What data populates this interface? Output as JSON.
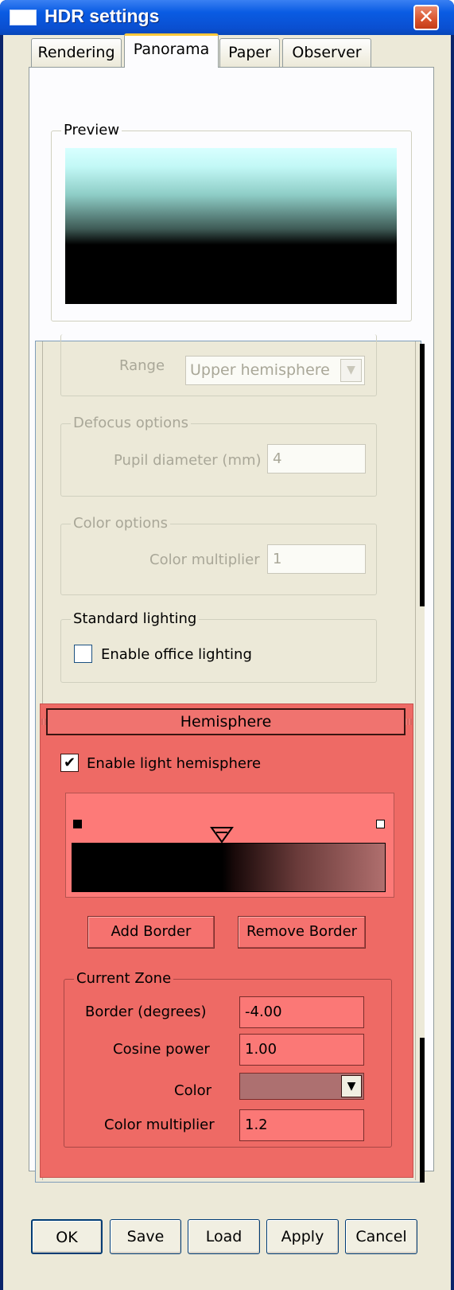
{
  "window": {
    "title": "HDR settings",
    "close_glyph": "✕"
  },
  "tabs": [
    {
      "label": "Rendering",
      "active": false
    },
    {
      "label": "Panorama",
      "active": true
    },
    {
      "label": "Paper",
      "active": false
    },
    {
      "label": "Observer",
      "active": false
    }
  ],
  "preview": {
    "legend": "Preview"
  },
  "range": {
    "label": "Range",
    "value": "Upper hemisphere"
  },
  "defocus": {
    "legend": "Defocus options",
    "pupil_label": "Pupil diameter (mm)",
    "pupil_value": "4"
  },
  "color_options": {
    "legend": "Color options",
    "multiplier_label": "Color multiplier",
    "multiplier_value": "1"
  },
  "standard_lighting": {
    "legend": "Standard lighting",
    "office_label": "Enable office lighting",
    "office_checked": false
  },
  "hemisphere": {
    "header": "Hemisphere",
    "enable_label": "Enable light hemisphere",
    "enable_checked": true,
    "enable_glyph": "✔",
    "add_border": "Add Border",
    "remove_border": "Remove Border",
    "zone_legend": "Current Zone",
    "border_label": "Border (degrees)",
    "border_value": "-4.00",
    "cosine_label": "Cosine power",
    "cosine_value": "1.00",
    "color_label": "Color",
    "color_swatch": "#ad7070",
    "color_multiplier_label": "Color multiplier",
    "color_multiplier_value": "1.2"
  },
  "buttons": {
    "ok": "OK",
    "save": "Save",
    "load": "Load",
    "apply": "Apply",
    "cancel": "Cancel"
  },
  "colors": {
    "hemisphere_bg": "#ee6a65",
    "title_bar": "#0a5ce3"
  }
}
